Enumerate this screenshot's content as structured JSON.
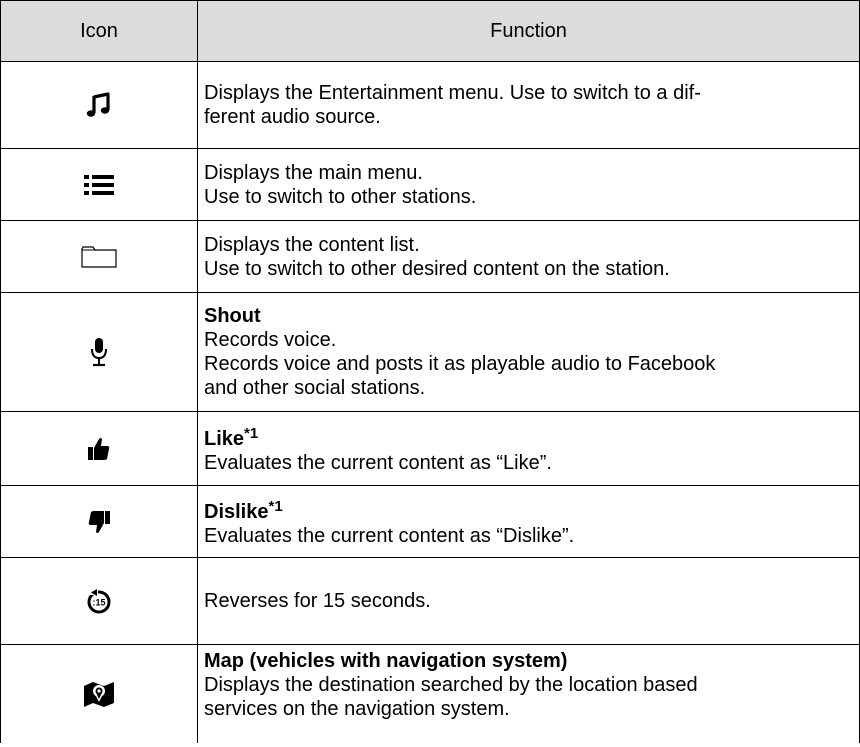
{
  "table": {
    "headers": {
      "icon": "Icon",
      "function": "Function"
    },
    "rows": [
      {
        "icon_name": "music-note-icon",
        "lines": [
          "Displays the Entertainment menu. Use to switch to a dif-",
          "ferent audio source."
        ]
      },
      {
        "icon_name": "list-menu-icon",
        "lines": [
          "Displays the main menu.",
          "Use to switch to other stations."
        ]
      },
      {
        "icon_name": "folder-icon",
        "lines": [
          "Displays the content list.",
          "Use to switch to other desired content on the station."
        ]
      },
      {
        "icon_name": "microphone-icon",
        "title": "Shout",
        "lines": [
          "Records voice.",
          "Records voice and posts it as playable audio to Facebook",
          "and other social stations."
        ]
      },
      {
        "icon_name": "thumbs-up-icon",
        "title": "Like",
        "note_mark": "*1",
        "lines": [
          "Evaluates the current content as “Like”."
        ]
      },
      {
        "icon_name": "thumbs-down-icon",
        "title": "Dislike",
        "note_mark": "*1",
        "lines": [
          "Evaluates the current content as “Dislike”."
        ]
      },
      {
        "icon_name": "rewind-15-icon",
        "icon_text": ":15",
        "lines": [
          "Reverses for 15 seconds."
        ]
      },
      {
        "icon_name": "map-pin-icon",
        "title": "Map (vehicles with navigation system)",
        "lines": [
          "Displays the destination searched by the location based",
          "services on the navigation system."
        ]
      }
    ]
  }
}
